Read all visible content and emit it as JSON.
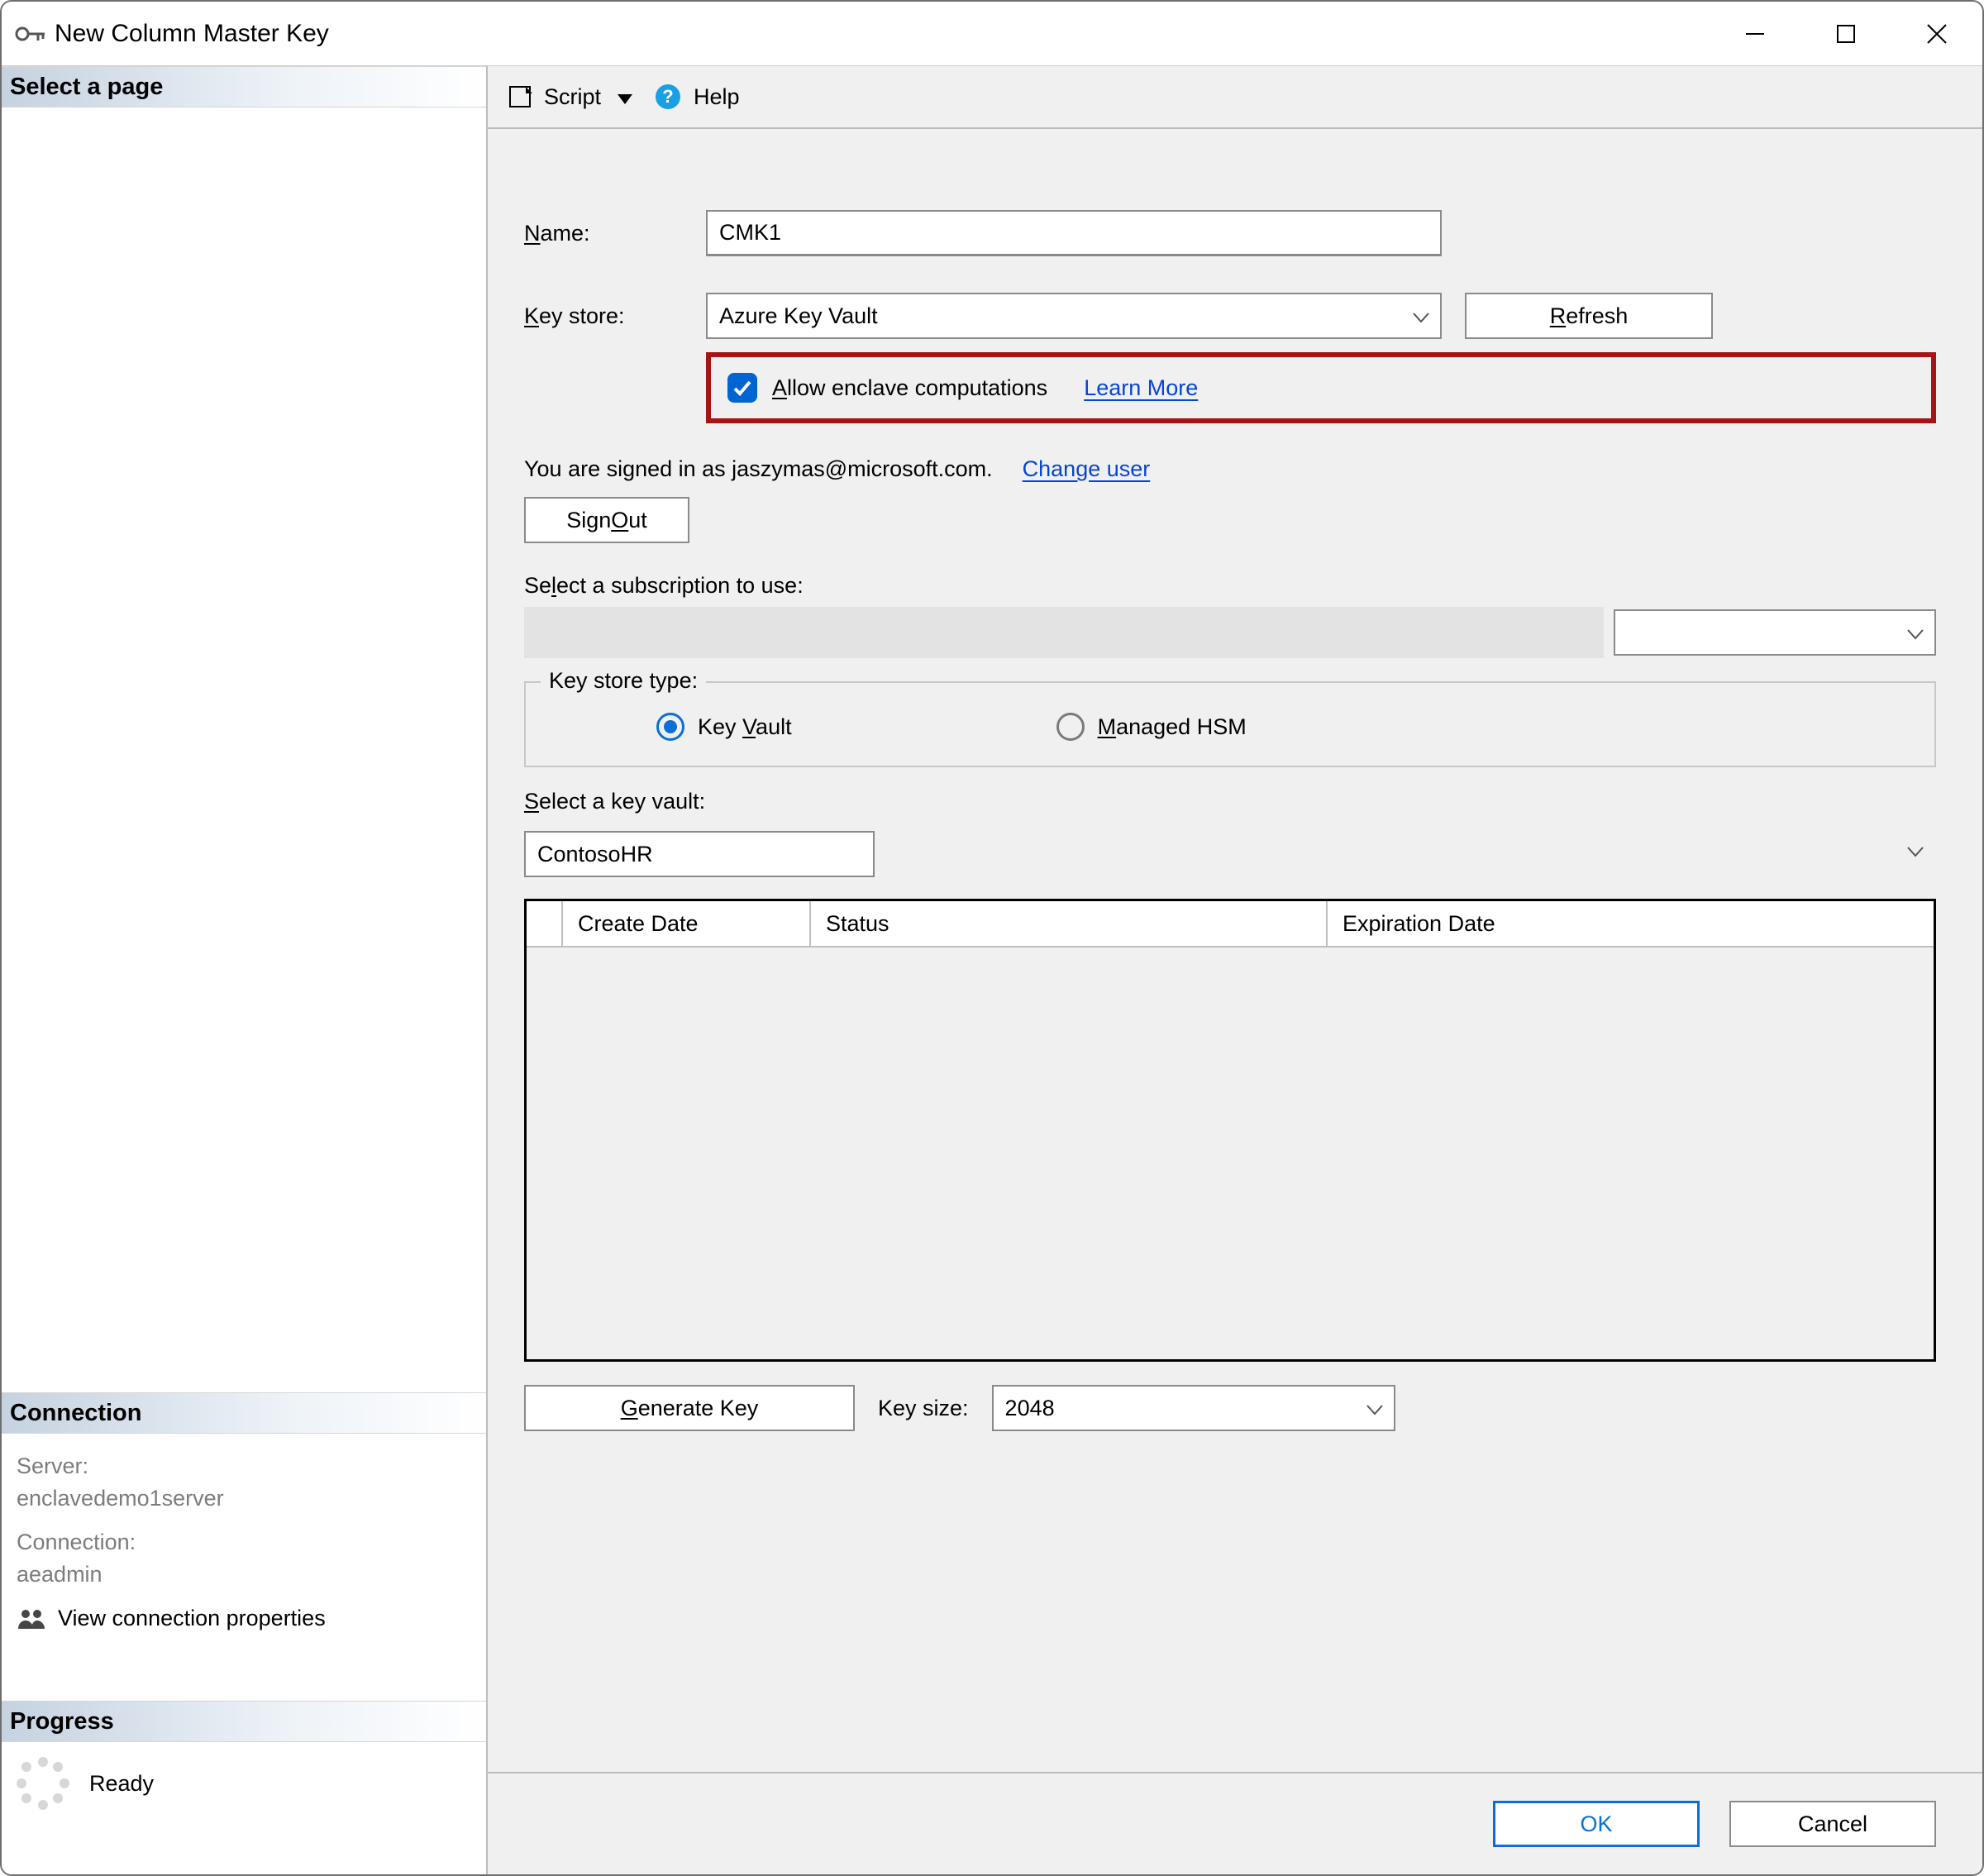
{
  "titlebar": {
    "title": "New Column Master Key"
  },
  "left": {
    "select_page_header": "Select a page",
    "connection_header": "Connection",
    "server_label": "Server:",
    "server_value": "enclavedemo1server",
    "connection_label": "Connection:",
    "connection_value": "aeadmin",
    "view_props": "View connection properties",
    "progress_header": "Progress",
    "progress_status": "Ready"
  },
  "toolbar": {
    "script": "Script",
    "help": "Help"
  },
  "form": {
    "name_label_pre": "N",
    "name_label_post": "ame:",
    "name_value": "CMK1",
    "keystore_label_pre": "K",
    "keystore_label_post": "ey store:",
    "keystore_value": "Azure Key Vault",
    "refresh_pre": "R",
    "refresh_post": "efresh",
    "enclave_pre": "A",
    "enclave_post": "llow enclave computations",
    "learn_more": "Learn More",
    "signed_in_text": "You are signed in as jaszymas@microsoft.com.",
    "change_user": "Change user",
    "signout_pre": "Sign ",
    "signout_u": "O",
    "signout_post": "ut",
    "sub_label_pre": "Se",
    "sub_label_u": "l",
    "sub_label_post": "ect a subscription to use:",
    "keystoretype_legend": "Key store type:",
    "radio_kv_pre": "Key ",
    "radio_kv_u": "V",
    "radio_kv_post": "ault",
    "radio_hsm_u": "M",
    "radio_hsm_post": "anaged HSM",
    "kv_label_u": "S",
    "kv_label_post": "elect a key vault:",
    "kv_value": "ContosoHR",
    "table": {
      "c1": "Create Date",
      "c2": "Status",
      "c3": "Expiration Date"
    },
    "gen_u": "G",
    "gen_post": "enerate Key",
    "keysize_label": "Key size:",
    "keysize_value": "2048"
  },
  "footer": {
    "ok": "OK",
    "cancel": "Cancel"
  }
}
